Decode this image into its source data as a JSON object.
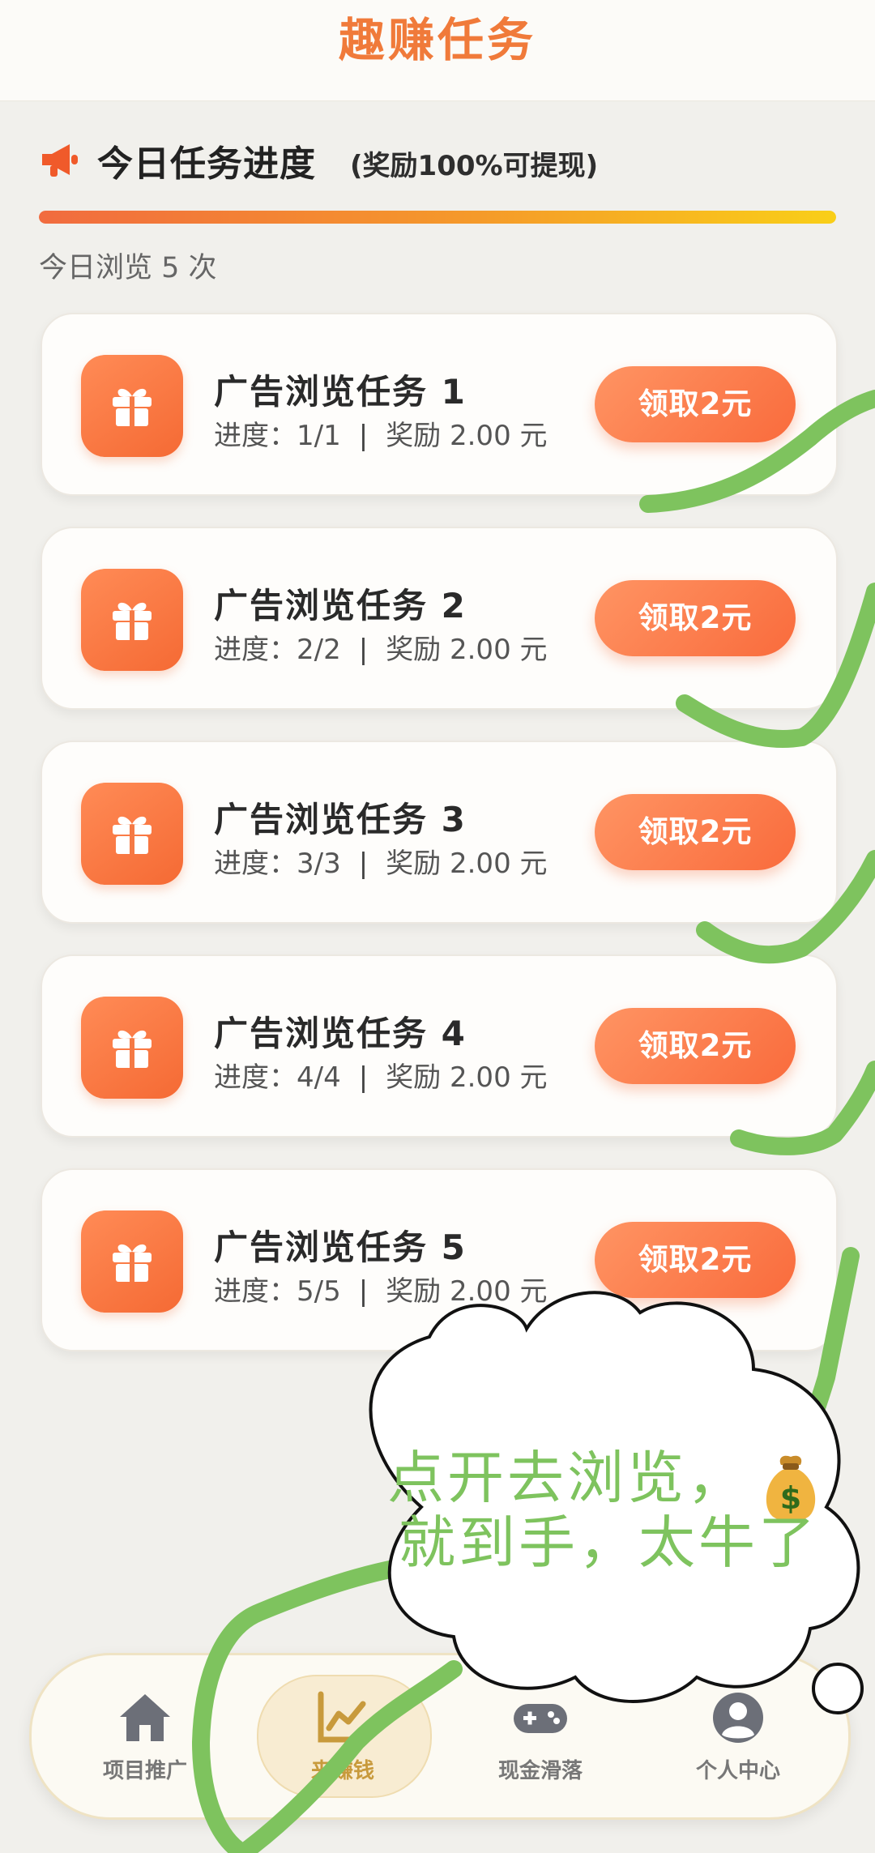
{
  "header": {
    "title": "趣赚任务"
  },
  "progress": {
    "title": "今日任务进度",
    "note": "(奖励100%可提现)",
    "fill_fraction": 1.0,
    "view_count_text": "今日浏览 5 次"
  },
  "tasks": [
    {
      "name": "广告浏览任务 1",
      "progress": "进度：1/1",
      "reward": "奖励 2.00 元",
      "button": "领取2元",
      "icon": "gift-icon"
    },
    {
      "name": "广告浏览任务 2",
      "progress": "进度：2/2",
      "reward": "奖励 2.00 元",
      "button": "领取2元",
      "icon": "gift-icon"
    },
    {
      "name": "广告浏览任务 3",
      "progress": "进度：3/3",
      "reward": "奖励 2.00 元",
      "button": "领取2元",
      "icon": "gift-icon"
    },
    {
      "name": "广告浏览任务 4",
      "progress": "进度：4/4",
      "reward": "奖励 2.00 元",
      "button": "领取2元",
      "icon": "gift-icon"
    },
    {
      "name": "广告浏览任务 5",
      "progress": "进度：5/5",
      "reward": "奖励 2.00 元",
      "button": "领取2元",
      "icon": "gift-icon"
    }
  ],
  "separator": "|",
  "tabbar": {
    "tabs": [
      {
        "label": "项目推广",
        "icon": "home-icon",
        "active": false
      },
      {
        "label": "来赚钱",
        "icon": "chart-icon",
        "active": true
      },
      {
        "label": "现金滑落",
        "icon": "gamepad-icon",
        "active": false
      },
      {
        "label": "个人中心",
        "icon": "user-icon",
        "active": false
      }
    ]
  },
  "overlay": {
    "bubble_line1": "点开去浏览，",
    "bubble_line2": "就到手，太牛了",
    "emoji": "money-bag-icon"
  },
  "colors": {
    "accent": "#f07a3a",
    "button": "#f96b3c",
    "active_tab": "#c89a3c",
    "scribble": "#7ec35e"
  }
}
